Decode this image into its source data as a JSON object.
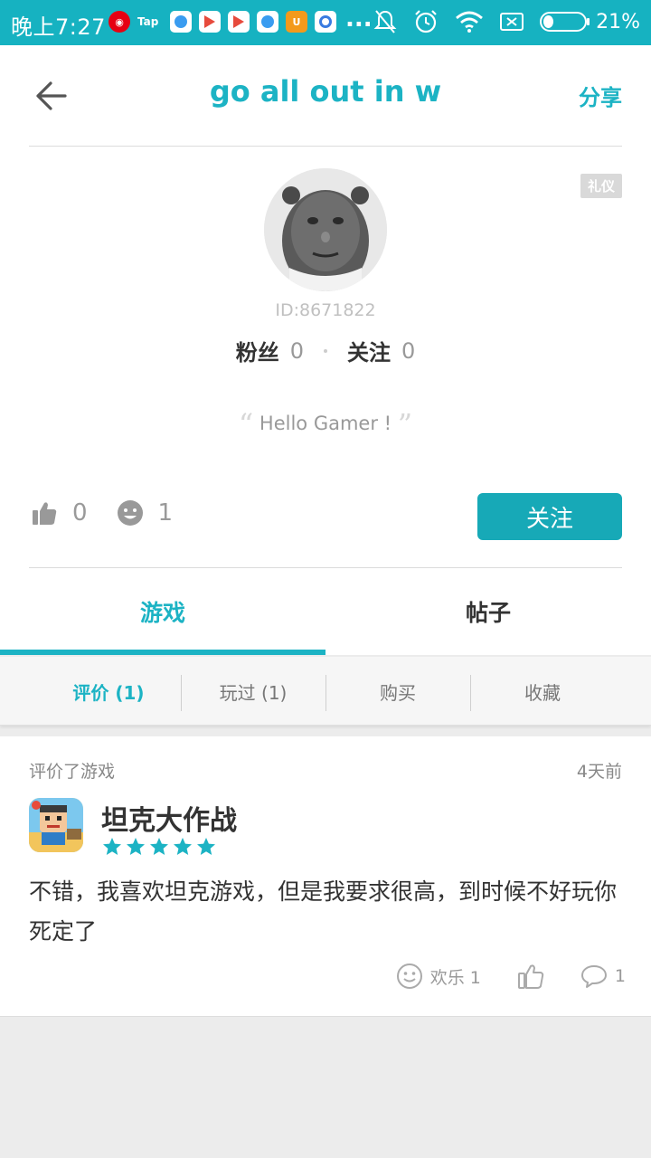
{
  "status_bar": {
    "time": "晚上7:27",
    "battery": "21%",
    "app_tap_label": "Tap",
    "more": "..."
  },
  "header": {
    "title": "go all out in w",
    "share_label": "分享"
  },
  "profile": {
    "badge": "礼仪",
    "user_id": "ID:8671822",
    "fans_label": "粉丝",
    "fans_count": "0",
    "following_label": "关注",
    "following_count": "0",
    "motto": "Hello Gamer !",
    "likes_count": "0",
    "fun_count": "1",
    "follow_button": "关注"
  },
  "tabs": [
    {
      "label": "游戏",
      "active": true
    },
    {
      "label": "帖子",
      "active": false
    }
  ],
  "subtabs": [
    {
      "label": "评价 (1)",
      "active": true
    },
    {
      "label": "玩过 (1)",
      "active": false
    },
    {
      "label": "购买",
      "active": false
    },
    {
      "label": "收藏",
      "active": false
    }
  ],
  "review": {
    "action_label": "评价了游戏",
    "time": "4天前",
    "game_name": "坦克大作战",
    "rating": 5,
    "text": "不错，我喜欢坦克游戏，但是我要求很高，到时候不好玩你死定了",
    "fun_label": "欢乐 1",
    "comment_count": "1"
  },
  "colors": {
    "accent": "#1cb3c4",
    "status_bar": "#16b2c1",
    "button": "#17a9b7"
  }
}
